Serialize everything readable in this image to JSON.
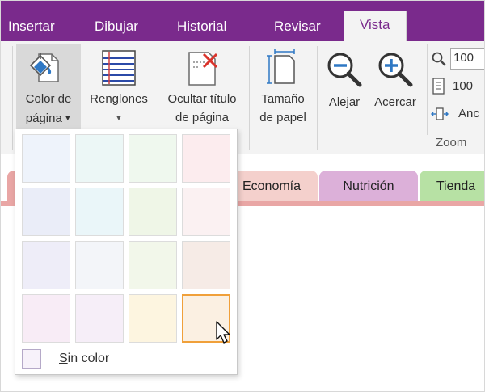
{
  "ribbon_tabs": [
    {
      "label": "Insertar"
    },
    {
      "label": "Dibujar"
    },
    {
      "label": "Historial"
    },
    {
      "label": "Revisar"
    },
    {
      "label": "Vista",
      "active": true
    }
  ],
  "ribbon": {
    "page_color": {
      "line1": "Color de",
      "line2": "página",
      "icon": "paint-bucket-page-icon"
    },
    "rule_lines": {
      "label": "Renglones",
      "icon": "ruled-lines-icon"
    },
    "hide_title": {
      "line1": "Ocultar título",
      "line2": "de página",
      "icon": "hide-title-icon"
    },
    "paper_size": {
      "line1": "Tamaño",
      "line2": "de papel",
      "icon": "paper-size-icon"
    },
    "zoom_out": {
      "label": "Alejar",
      "icon": "zoom-out-icon"
    },
    "zoom_in": {
      "label": "Acercar",
      "icon": "zoom-in-icon"
    },
    "zoom_value": "100",
    "page_width_value": "100",
    "page_width_label": "Anc",
    "zoom_group_label": "Zoom"
  },
  "section_tabs": [
    {
      "label": "Economía",
      "color": "#f4d0cc"
    },
    {
      "label": "Nutrición",
      "color": "#dcb0d9"
    },
    {
      "label": "Tienda",
      "color": "#b7e1a4"
    }
  ],
  "page_color_dropdown": {
    "swatches": [
      [
        "#eef3fb",
        "#ecf7f6",
        "#eff8ee",
        "#fcecee"
      ],
      [
        "#eaedf8",
        "#eaf6f9",
        "#eff6e7",
        "#fbf1f2"
      ],
      [
        "#eeedf8",
        "#f3f5f9",
        "#f2f7ea",
        "#f6ebe6"
      ],
      [
        "#f8ecf6",
        "#f6eef8",
        "#fdf5e0",
        "#fbf0e2"
      ]
    ],
    "selected": [
      3,
      3
    ],
    "no_color_label_first": "S",
    "no_color_label_rest": "in color"
  }
}
